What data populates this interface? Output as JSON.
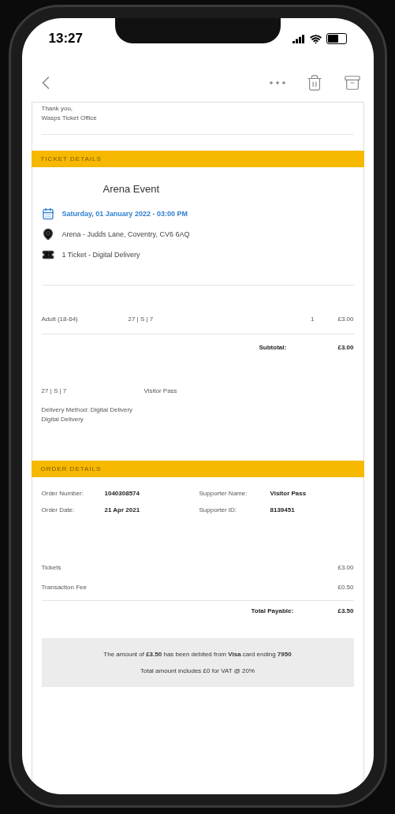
{
  "status_bar": {
    "time": "13:27"
  },
  "intro": {
    "lines": [
      "Thank you,",
      "Wasps Ticket Office"
    ]
  },
  "ticket_details": {
    "heading": "TICKET DETAILS",
    "event": "Arena Event",
    "info": [
      {
        "kind": "date",
        "text": "Saturday, 01 January 2022 - 03:00 PM"
      },
      {
        "kind": "location",
        "text": "Arena - Judds Lane, Coventry, CV6 6AQ"
      },
      {
        "kind": "ticket",
        "text": "1 Ticket - Digital Delivery"
      }
    ],
    "rows": [
      {
        "item": "Adult (18-64)",
        "seat": "27 | S | 7",
        "qty": "1",
        "price": "£3.00"
      }
    ],
    "subtotal_label": "Subtotal:",
    "subtotal": "£3.00",
    "seat": "27 | S | 7",
    "holder": "Visitor Pass",
    "delivery": [
      "Delivery Method: Digital Delivery",
      "Digital Delivery"
    ]
  },
  "order_details": {
    "heading": "ORDER DETAILS",
    "fields": [
      {
        "label": "Order Number:",
        "value": "1040308574"
      },
      {
        "label": "Supporter Name:",
        "value": "Visitor Pass"
      },
      {
        "label": "Order Date:",
        "value": "21 Apr 2021"
      },
      {
        "label": "Supporter ID:",
        "value": "8139451"
      }
    ],
    "lines": [
      {
        "label": "Tickets",
        "value": "£3.00"
      },
      {
        "label": "Transaction Fee",
        "value": "£0.50"
      }
    ],
    "total_label": "Total Payable:",
    "total": "£3.50"
  },
  "payment_note": [
    "The amount of **£3.50** has been debited from **Visa** card ending **7950**",
    "Total amount includes £0 for VAT @ 20%"
  ]
}
